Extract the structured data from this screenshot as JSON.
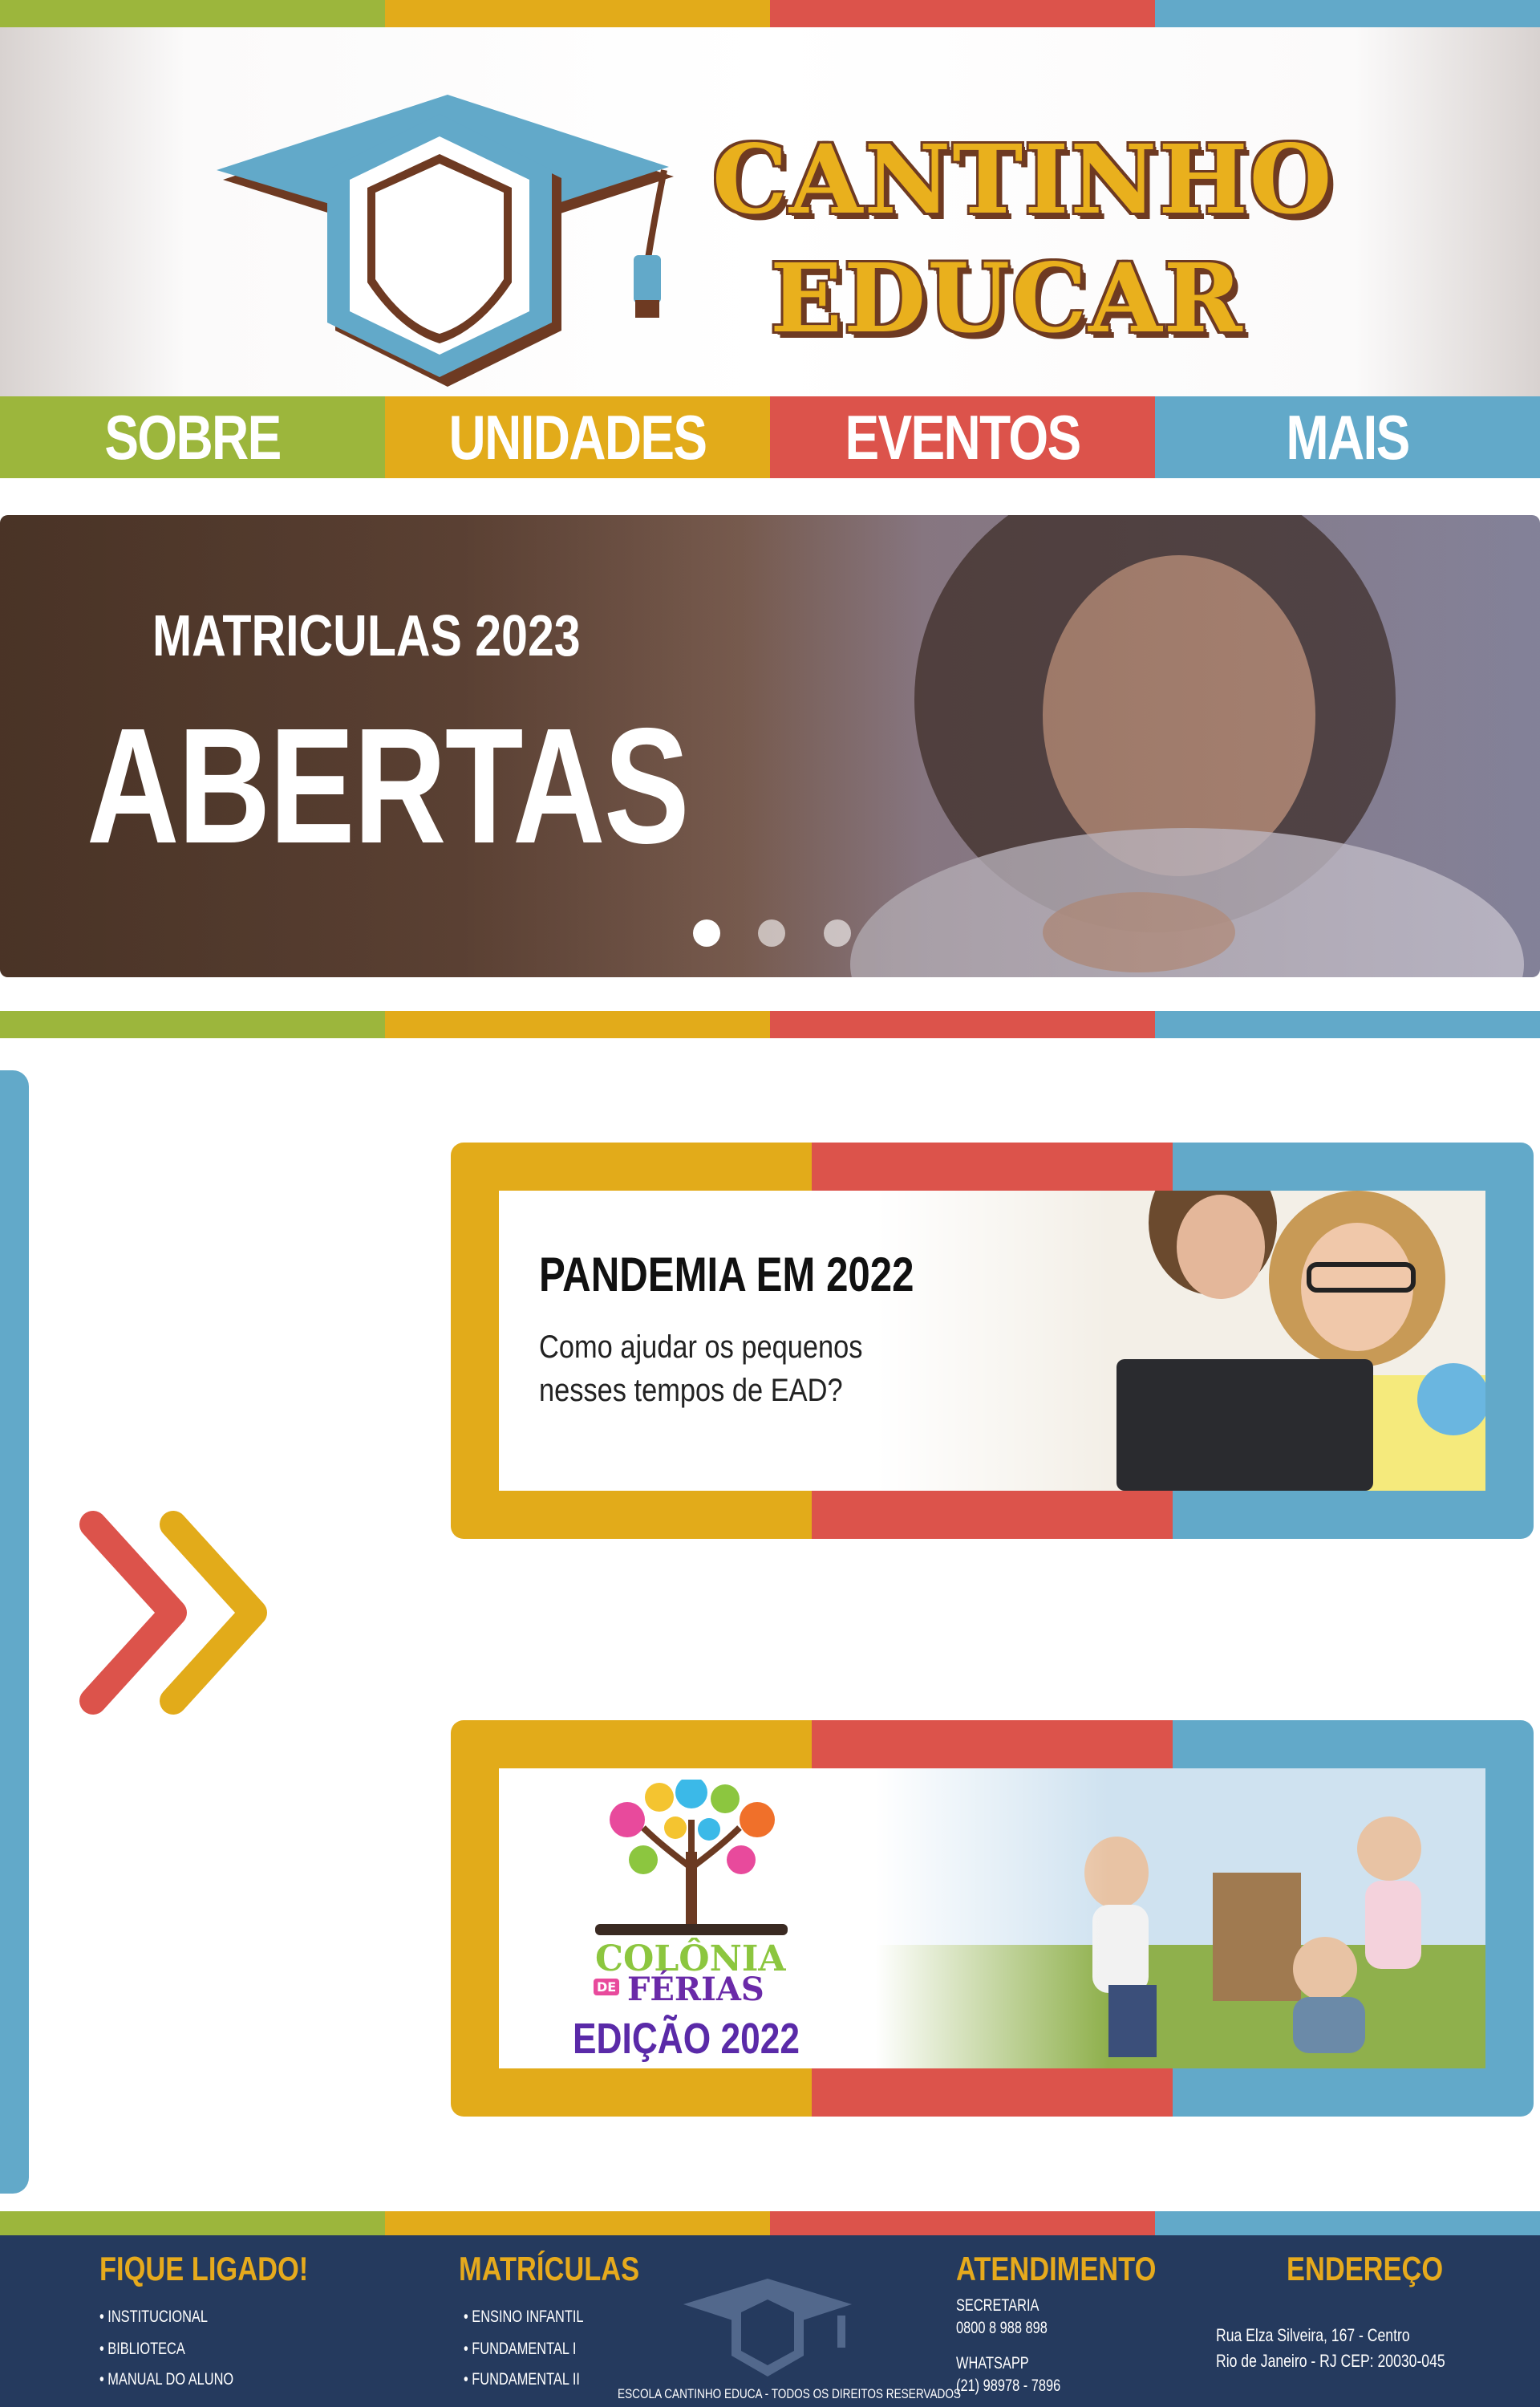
{
  "brand": {
    "line1": "CANTINHO",
    "line2": "EDUCAR"
  },
  "nav": {
    "items": [
      {
        "label": "SOBRE",
        "color": "#9cb63c"
      },
      {
        "label": "UNIDADES",
        "color": "#e2ab1a"
      },
      {
        "label": "EVENTOS",
        "color": "#dc534b"
      },
      {
        "label": "MAIS",
        "color": "#62a9c9"
      }
    ]
  },
  "colors": {
    "green": "#9cb63c",
    "yellow": "#e2ab1a",
    "red": "#dc534b",
    "blue": "#62a9c9",
    "footer": "#253a5e",
    "brown": "#6e3a22"
  },
  "hero": {
    "subtitle": "MATRICULAS 2023",
    "title": "ABERTAS",
    "slide_count": 3,
    "active_slide": 1
  },
  "cards": [
    {
      "title": "PANDEMIA EM 2022",
      "text_line1": "Como ajudar os pequenos",
      "text_line2": "nesses tempos de EAD?"
    },
    {
      "logo_top": "COLÔNIA",
      "logo_mid": "DE",
      "logo_bottom": "FÉRIAS",
      "edition": "EDIÇÃO 2022"
    }
  ],
  "footer": {
    "col1": {
      "heading": "FIQUE LIGADO!",
      "items": [
        "• INSTITUCIONAL",
        "• BIBLIOTECA",
        "• MANUAL DO ALUNO"
      ]
    },
    "col2": {
      "heading": "MATRÍCULAS",
      "items": [
        "• ENSINO INFANTIL",
        "• FUNDAMENTAL I",
        "• FUNDAMENTAL II"
      ]
    },
    "col3": {
      "heading": "ATENDIMENTO",
      "secretaria_label": "SECRETARIA",
      "secretaria_phone": "0800 8 988 898",
      "whatsapp_label": "WHATSAPP",
      "whatsapp_phone": "(21) 98978 - 7896"
    },
    "col4": {
      "heading": "ENDEREÇO",
      "line1": "Rua Elza Silveira, 167 - Centro",
      "line2": "Rio de Janeiro - RJ CEP: 20030-045"
    },
    "copyright": "ESCOLA CANTINHO EDUCA - TODOS OS DIREITOS RESERVADOS"
  }
}
